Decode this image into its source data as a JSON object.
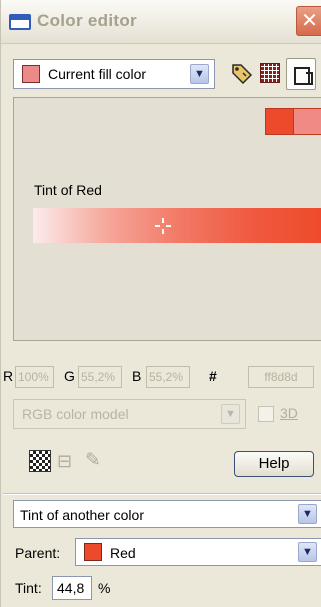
{
  "window": {
    "title": "Color editor"
  },
  "toolbar": {
    "current_color": {
      "label": "Current fill color",
      "swatch": "#ec8a8a"
    }
  },
  "editor": {
    "preview_colors": [
      "#ec4a2a",
      "#ef8a84"
    ],
    "tint_label": "Tint of Red",
    "gradient": {
      "start": "#fbeceb",
      "end": "#ee4a2a"
    }
  },
  "rgb": {
    "r_label": "R",
    "r_value": "100%",
    "g_label": "G",
    "g_value": "55,2%",
    "b_label": "B",
    "b_value": "55,2%",
    "hex_label": "#",
    "hex_value": "ff8d8d"
  },
  "model": {
    "value": "RGB color model",
    "option_3d": "3D"
  },
  "help_label": "Help",
  "type": {
    "value": "Tint of another color"
  },
  "parent": {
    "label": "Parent:",
    "value": "Red",
    "swatch": "#ec4a2a"
  },
  "tint": {
    "label": "Tint:",
    "value": "44,8",
    "unit": "%"
  }
}
